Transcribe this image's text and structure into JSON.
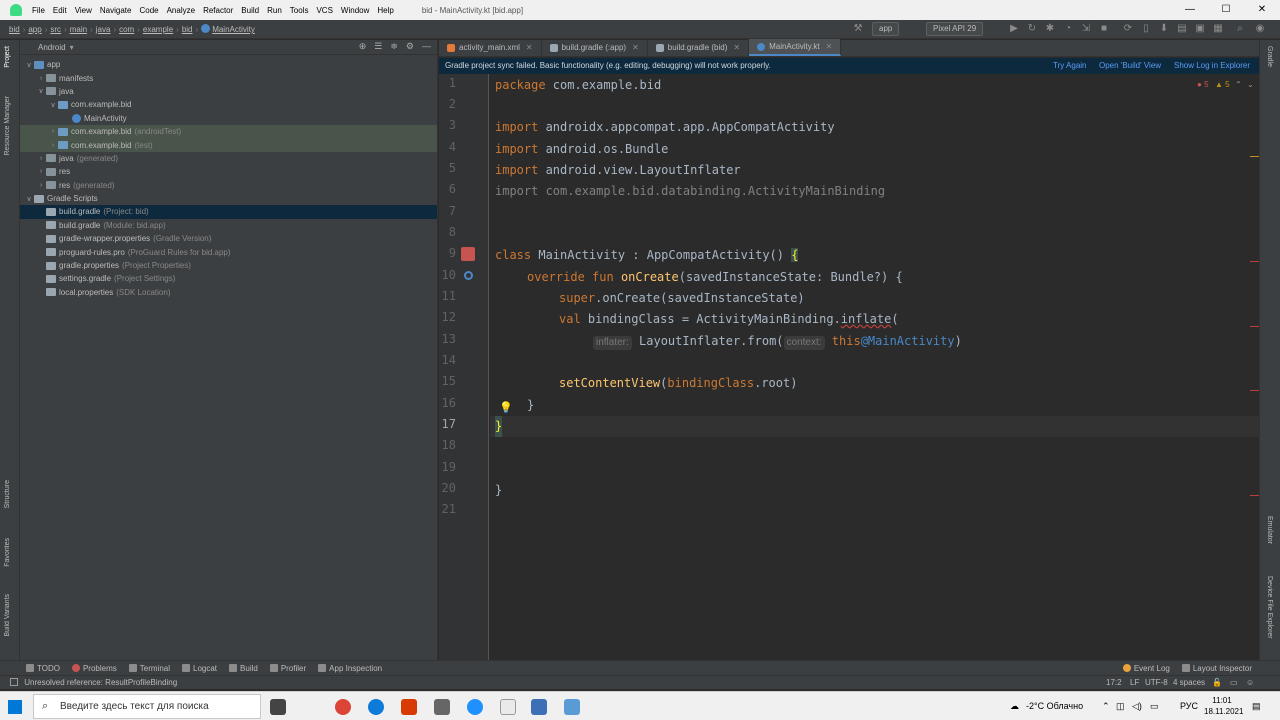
{
  "menubar": {
    "items": [
      "File",
      "Edit",
      "View",
      "Navigate",
      "Code",
      "Analyze",
      "Refactor",
      "Build",
      "Run",
      "Tools",
      "VCS",
      "Window",
      "Help"
    ],
    "window_title": "bid - MainActivity.kt [bid.app]",
    "minimize": "—",
    "maximize": "☐",
    "close": "✕"
  },
  "breadcrumbs": [
    "bid",
    "app",
    "src",
    "main",
    "java",
    "com",
    "example",
    "bid",
    "MainActivity"
  ],
  "toolbar": {
    "run_config": "app",
    "device": "Pixel API 29"
  },
  "left_tabs": [
    "Project",
    "Resource Manager",
    "Structure",
    "Favorites",
    "Build Variants"
  ],
  "right_tabs": [
    "Gradle",
    "Emulator",
    "Device File Explorer"
  ],
  "project": {
    "view_mode": "Android",
    "tree": [
      {
        "label": "app",
        "muted": ""
      },
      {
        "label": "manifests",
        "muted": ""
      },
      {
        "label": "java",
        "muted": ""
      },
      {
        "label": "com.example.bid",
        "muted": ""
      },
      {
        "label": "MainActivity",
        "muted": ""
      },
      {
        "label": "com.example.bid",
        "muted": "(androidTest)"
      },
      {
        "label": "com.example.bid",
        "muted": "(test)"
      },
      {
        "label": "java",
        "muted": "(generated)"
      },
      {
        "label": "res",
        "muted": ""
      },
      {
        "label": "res",
        "muted": "(generated)"
      },
      {
        "label": "Gradle Scripts",
        "muted": ""
      },
      {
        "label": "build.gradle",
        "muted": "(Project: bid)"
      },
      {
        "label": "build.gradle",
        "muted": "(Module: bid.app)"
      },
      {
        "label": "gradle-wrapper.properties",
        "muted": "(Gradle Version)"
      },
      {
        "label": "proguard-rules.pro",
        "muted": "(ProGuard Rules for bid.app)"
      },
      {
        "label": "gradle.properties",
        "muted": "(Project Properties)"
      },
      {
        "label": "settings.gradle",
        "muted": "(Project Settings)"
      },
      {
        "label": "local.properties",
        "muted": "(SDK Location)"
      }
    ]
  },
  "tabs": [
    "activity_main.xml",
    "build.gradle (:app)",
    "build.gradle (bid)",
    "MainActivity.kt"
  ],
  "notification": {
    "message": "Gradle project sync failed. Basic functionality (e.g. editing, debugging) will not work properly.",
    "try_again": "Try Again",
    "open_build": "Open 'Build' View",
    "show_log": "Show Log in Explorer"
  },
  "inspections": {
    "errors": "5",
    "warnings": "5"
  },
  "code": {
    "line_numbers": [
      "1",
      "2",
      "3",
      "4",
      "5",
      "6",
      "7",
      "8",
      "9",
      "10",
      "11",
      "12",
      "13",
      "14",
      "15",
      "16",
      "17",
      "18",
      "19",
      "20",
      "21"
    ],
    "l1_kw": "package",
    "l1_rest": " com.example.bid",
    "l3_kw": "import",
    "l3_rest": " androidx.appcompat.app.AppCompatActivity",
    "l4_kw": "import",
    "l4_rest": " android.os.Bundle",
    "l5_kw": "import",
    "l5_rest": " android.view.LayoutInflater",
    "l6": "import com.example.bid.databinding.ActivityMainBinding",
    "l9_kw": "class",
    "l9_rest": " MainActivity : AppCompatActivity() ",
    "l9_brace": "{",
    "l10_kw": "override fun",
    "l10_fn": "onCreate",
    "l10_rest": "(savedInstanceState: Bundle?) {",
    "l11_kw": "super",
    "l11_rest": ".onCreate(savedInstanceState)",
    "l12_kw": "val",
    "l12_rest": " bindingClass = ActivityMainBinding.",
    "l12_fn": "inflate",
    "l12_end": "(",
    "l13_hint1": "inflater:",
    "l13_mid": " LayoutInflater.from(",
    "l13_hint2": "context:",
    "l13_this": "this",
    "l13_label": "@MainActivity",
    "l13_end": ")",
    "l15_fn": "setContentView",
    "l15_open": "(",
    "l15_var": "bindingClass",
    "l15_rest": ".root)",
    "l16": "}",
    "l17": "}",
    "l20": "}"
  },
  "bottom_tools": [
    "TODO",
    "Problems",
    "Terminal",
    "Logcat",
    "Build",
    "Profiler",
    "App Inspection"
  ],
  "bottom_right_tools": [
    "Event Log",
    "Layout Inspector"
  ],
  "status": {
    "message": "Unresolved reference: ResultProfileBinding",
    "position": "17:2",
    "line_sep": "LF",
    "encoding": "UTF-8",
    "indent": "4 spaces"
  },
  "taskbar": {
    "search_placeholder": "Введите здесь текст для поиска",
    "weather": "-2°C  Облачно",
    "lang": "РУС",
    "time": "11:01",
    "date": "18.11.2021"
  },
  "colors": {
    "keyword": "#cc7832",
    "function": "#ffc66d",
    "purple": "#9876aa",
    "default_text": "#a9b7c6",
    "error": "#bc3f3c",
    "link": "#589df6"
  }
}
